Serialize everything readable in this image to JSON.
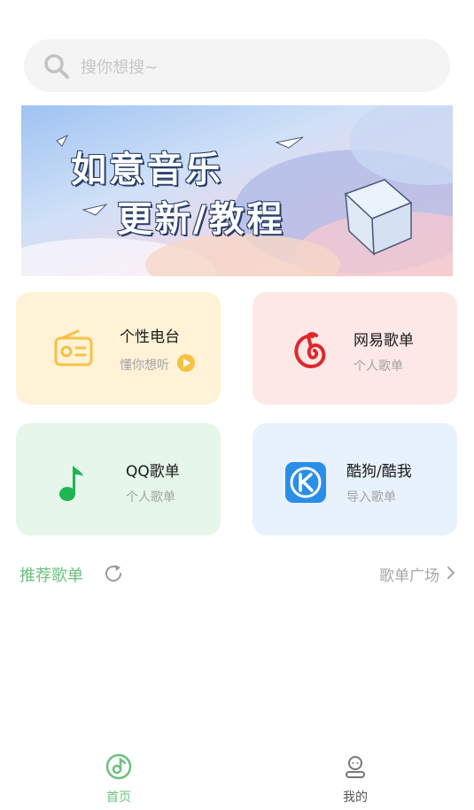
{
  "search": {
    "placeholder": "搜你想搜~"
  },
  "banner": {
    "line1": "如意音乐",
    "line2": "更新/教程"
  },
  "cards": [
    {
      "title": "个性电台",
      "subtitle": "懂你想听",
      "icon": "radio-icon",
      "color": "#f5c242"
    },
    {
      "title": "网易歌单",
      "subtitle": "个人歌单",
      "icon": "netease-music-icon",
      "color": "#e0262a"
    },
    {
      "title": "QQ歌单",
      "subtitle": "个人歌单",
      "icon": "qq-music-note-icon",
      "color": "#1fb553"
    },
    {
      "title": "酷狗/酷我",
      "subtitle": "导入歌单",
      "icon": "kugou-k-icon",
      "color": "#2a8ee8"
    }
  ],
  "recommend": {
    "title": "推荐歌单",
    "plaza": "歌单广场"
  },
  "tabbar": [
    {
      "label": "首页",
      "active": true,
      "color": "#6cc07d"
    },
    {
      "label": "我的",
      "active": false,
      "color": "#666666"
    }
  ]
}
